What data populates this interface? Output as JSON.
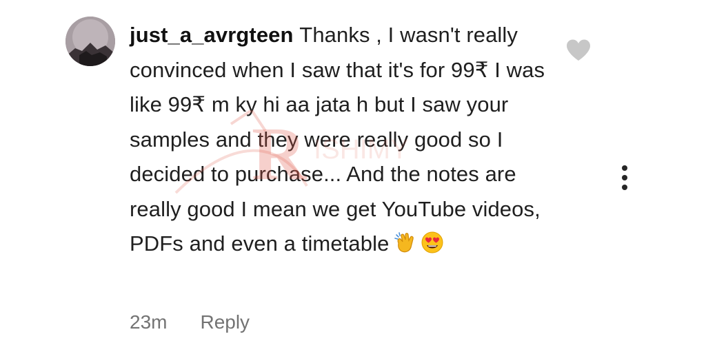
{
  "comment": {
    "username": "just_a_avrgteen",
    "text": "Thanks , I wasn't really convinced when I saw that it's for 99₹ I was like 99₹ m ky hi aa jata h but I saw your samples and they were really good so I decided to purchase... And the notes are really good I mean we get YouTube videos, PDFs and even a timetable",
    "emojis": [
      "clapping-hands",
      "heart-eyes"
    ],
    "time": "23m",
    "reply_label": "Reply"
  },
  "icons": {
    "like": "heart-icon",
    "more": "more-vertical-icon"
  },
  "colors": {
    "text": "#1f1f1f",
    "meta": "#737373",
    "heart": "#c7c7c7",
    "watermark": "#e05a4a"
  }
}
